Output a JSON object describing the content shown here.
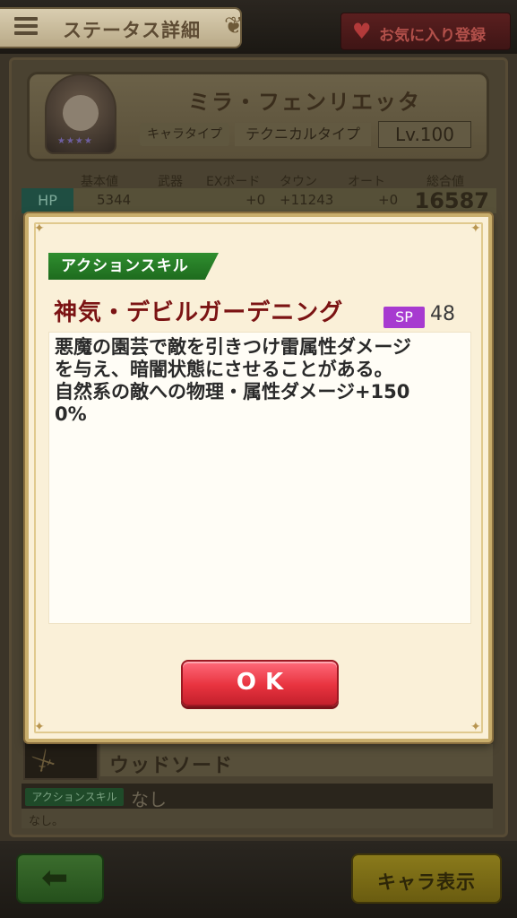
{
  "header": {
    "title": "ステータス詳細",
    "favorite_label": "お気に入り登録"
  },
  "profile": {
    "name": "ミラ・フェンリエッタ",
    "chara_type_label": "キャラタイプ",
    "chara_type_value": "テクニカルタイプ",
    "level": "Lv.100",
    "rarity_stars": "★★★★"
  },
  "stats": {
    "headers": [
      "基本値",
      "武器",
      "EXボード",
      "タウン",
      "オート",
      "総合値"
    ],
    "hp": {
      "label": "HP",
      "base": "5344",
      "weapon": "",
      "ex_board": "+0",
      "town": "+11243",
      "auto": "+0",
      "total": "16587"
    }
  },
  "weapon": {
    "name": "ウッドソード",
    "skill_tag": "アクションスキル",
    "skill_value": "なし",
    "skill_desc": "なし。"
  },
  "footer": {
    "chara_button_label": "キャラ表示"
  },
  "modal": {
    "skill_type": "アクションスキル",
    "skill_name": "神気・デビルガーデニング",
    "sp_label": "SP",
    "sp_value": "48",
    "description_lines": [
      "悪魔の園芸で敵を引きつけ雷属性ダメージ",
      "を与え、暗闇状態にさせることがある。",
      "自然系の敵への物理・属性ダメージ+150",
      "0%"
    ],
    "ok_label": "OK"
  }
}
